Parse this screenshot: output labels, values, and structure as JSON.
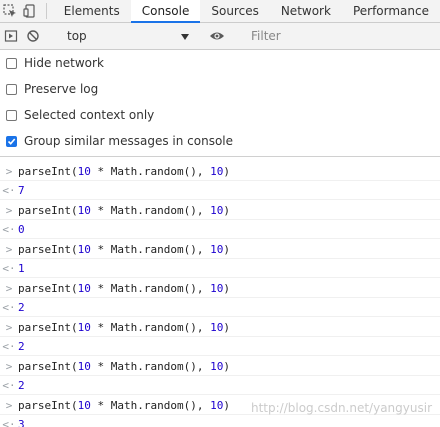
{
  "tabs": {
    "items": [
      "Elements",
      "Console",
      "Sources",
      "Network",
      "Performance"
    ],
    "active": "Console"
  },
  "toolbar": {
    "context": "top",
    "filter_placeholder": "Filter"
  },
  "settings": {
    "items": [
      {
        "label": "Hide network",
        "checked": false
      },
      {
        "label": "Preserve log",
        "checked": false
      },
      {
        "label": "Selected context only",
        "checked": false
      },
      {
        "label": "Group similar messages in console",
        "checked": true
      }
    ]
  },
  "console": {
    "entries": [
      {
        "input_fn": "parseInt(",
        "input_a": "10",
        "input_op": " * Math.random(), ",
        "input_b": "10",
        "input_close": ")",
        "output": "7"
      },
      {
        "input_fn": "parseInt(",
        "input_a": "10",
        "input_op": " * Math.random(), ",
        "input_b": "10",
        "input_close": ")",
        "output": "0"
      },
      {
        "input_fn": "parseInt(",
        "input_a": "10",
        "input_op": " * Math.random(), ",
        "input_b": "10",
        "input_close": ")",
        "output": "1"
      },
      {
        "input_fn": "parseInt(",
        "input_a": "10",
        "input_op": " * Math.random(), ",
        "input_b": "10",
        "input_close": ")",
        "output": "2"
      },
      {
        "input_fn": "parseInt(",
        "input_a": "10",
        "input_op": " * Math.random(), ",
        "input_b": "10",
        "input_close": ")",
        "output": "2"
      },
      {
        "input_fn": "parseInt(",
        "input_a": "10",
        "input_op": " * Math.random(), ",
        "input_b": "10",
        "input_close": ")",
        "output": "2"
      },
      {
        "input_fn": "parseInt(",
        "input_a": "10",
        "input_op": " * Math.random(), ",
        "input_b": "10",
        "input_close": ")",
        "output": "3"
      }
    ]
  },
  "watermark": "http://blog.csdn.net/yangyusir"
}
